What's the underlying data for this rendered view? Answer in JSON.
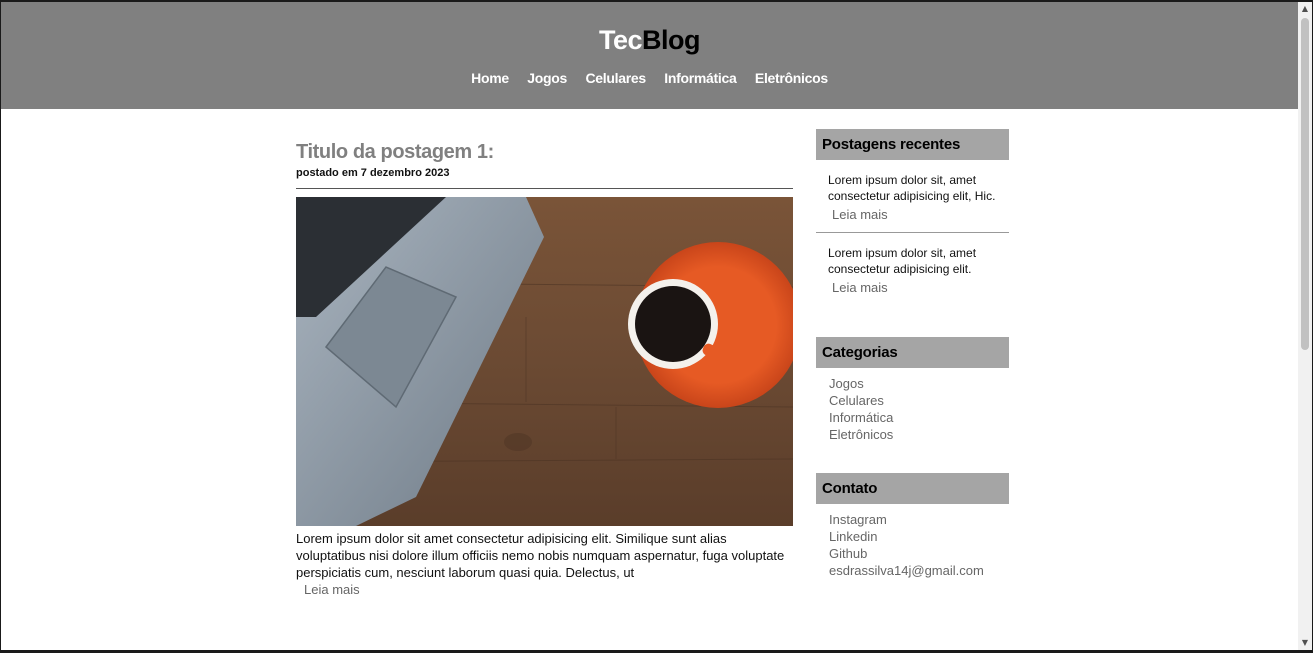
{
  "header": {
    "brand_part1": "Tec",
    "brand_part2": "Blog",
    "nav": [
      "Home",
      "Jogos",
      "Celulares",
      "Informática",
      "Eletrônicos"
    ]
  },
  "post": {
    "title": "Titulo da postagem 1:",
    "date": "postado em 7 dezembro 2023",
    "excerpt": "Lorem ipsum dolor sit amet consectetur adipisicing elit. Similique sunt alias voluptatibus nisi dolore illum officiis nemo nobis numquam aspernatur, fuga voluptate perspiciatis cum, nesciunt laborum quasi quia. Delectus, ut",
    "read_more": "Leia mais"
  },
  "sidebar": {
    "recent_title": "Postagens recentes",
    "recent": [
      {
        "text": "Lorem ipsum dolor sit, amet consectetur adipisicing elit, Hic.",
        "more": "Leia mais"
      },
      {
        "text": "Lorem ipsum dolor sit, amet consectetur adipisicing elit.",
        "more": "Leia mais"
      }
    ],
    "categories_title": "Categorias",
    "categories": [
      "Jogos",
      "Celulares",
      "Informática",
      "Eletrônicos"
    ],
    "contact_title": "Contato",
    "contact": [
      "Instagram",
      "Linkedin",
      "Github",
      "esdrassilva14j@gmail.com"
    ]
  },
  "colors": {
    "header_bg": "#808080",
    "widget_title_bg": "#a5a5a5",
    "saucer": "#e8531f",
    "laptop": "#8a96a3",
    "wood": "#6b4a33"
  },
  "icons": {
    "scroll_up": "triangle-up-icon",
    "scroll_down": "triangle-down-icon"
  }
}
